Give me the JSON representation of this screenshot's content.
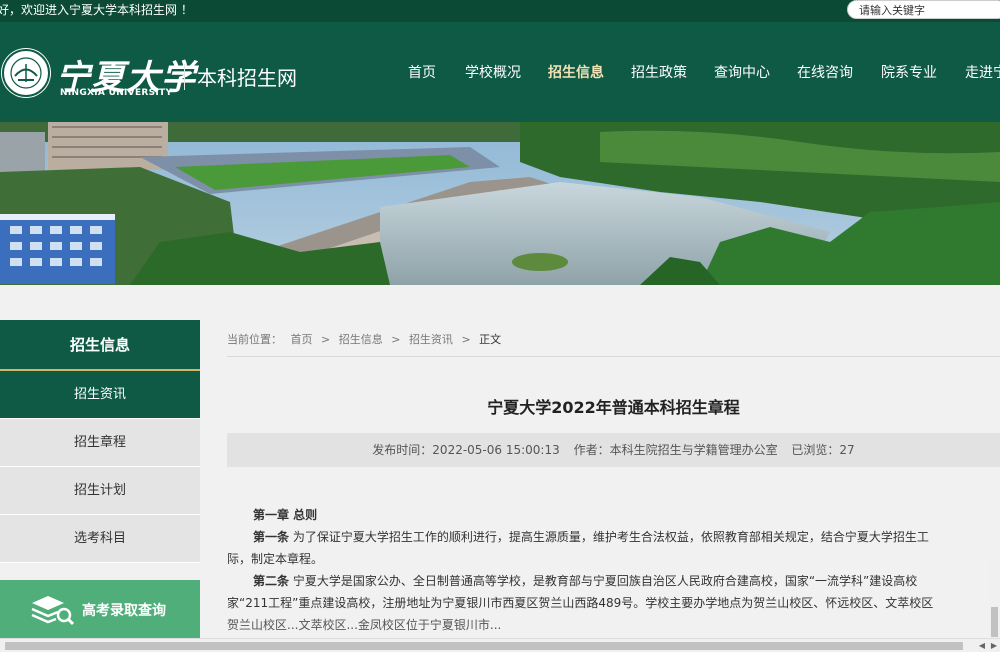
{
  "topbar": {
    "welcome": "好，欢迎进入宁夏大学本科招生网 ！",
    "search_placeholder": "请输入关键字"
  },
  "header": {
    "logo_cn": "宁夏大学",
    "logo_en": "NINGXIA UNIVERSITY",
    "site_title": "本科招生网",
    "brand_color": "#0f5a45",
    "accent_color": "#d4b66b"
  },
  "nav": {
    "items": [
      {
        "label": "首页"
      },
      {
        "label": "学校概况"
      },
      {
        "label": "招生信息",
        "active": true
      },
      {
        "label": "招生政策"
      },
      {
        "label": "查询中心"
      },
      {
        "label": "在线咨询"
      },
      {
        "label": "院系专业"
      },
      {
        "label": "走进宁"
      }
    ]
  },
  "sidebar": {
    "title": "招生信息",
    "items": [
      {
        "label": "招生资讯",
        "active": true
      },
      {
        "label": "招生章程"
      },
      {
        "label": "招生计划"
      },
      {
        "label": "选考科目"
      }
    ],
    "query_button": "高考录取查询"
  },
  "breadcrumb": {
    "prefix": "当前位置：",
    "items": [
      "首页",
      ">",
      "招生信息",
      ">",
      "招生资讯",
      ">",
      "正文"
    ]
  },
  "article": {
    "title": "宁夏大学2022年普通本科招生章程",
    "publish_time": "发布时间：2022-05-06 15:00:13",
    "author": "作者：本科生院招生与学籍管理办公室",
    "views": "已浏览：27",
    "chapter1": "第一章 总则",
    "a1_label": "第一条",
    "a1_line1": " 为了保证宁夏大学招生工作的顺利进行，提高生源质量，维护考生合法权益，依照教育部相关规定，结合宁夏大学招生工",
    "a1_line2": "际，制定本章程。",
    "a2_label": "第二条",
    "a2_line1": " 宁夏大学是国家公办、全日制普通高等学校，是教育部与宁夏回族自治区人民政府合建高校，国家“一流学科”建设高校",
    "a2_line2": "家“211工程”重点建设高校，注册地址为宁夏银川市西夏区贺兰山西路489号。学校主要办学地点为贺兰山校区、怀远校区、文萃校区",
    "a2_line3": "贺兰山校区...文萃校区...金凤校区位于宁夏银川市..."
  }
}
